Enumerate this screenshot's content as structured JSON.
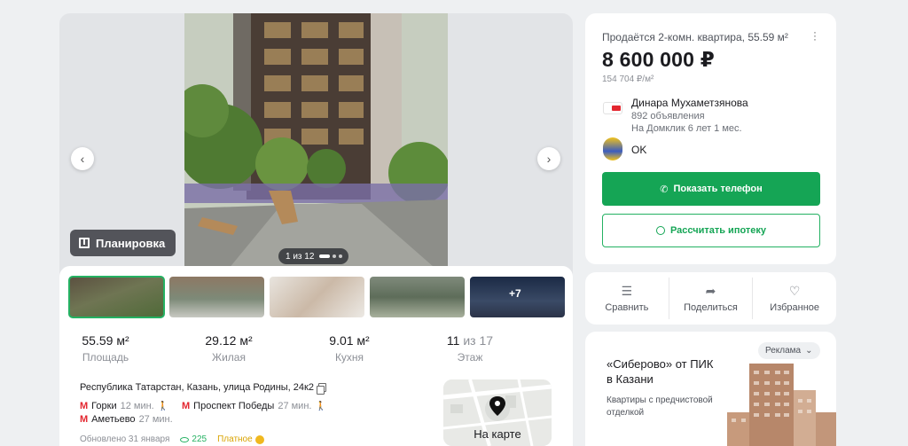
{
  "gallery": {
    "plan_label": "Планировка",
    "counter": "1 из 12",
    "extra_photos": "+7",
    "prev_icon": "chevron-left-icon",
    "next_icon": "chevron-right-icon"
  },
  "stats": [
    {
      "value": "55.59 м²",
      "label": "Площадь"
    },
    {
      "value": "29.12 м²",
      "label": "Жилая"
    },
    {
      "value": "9.01 м²",
      "label": "Кухня"
    },
    {
      "value": "11",
      "value_suffix": "из 17",
      "label": "Этаж"
    }
  ],
  "address": "Республика Татарстан, Казань, улица Родины, 24к2",
  "metro": [
    {
      "station": "Горки",
      "time": "12 мин."
    },
    {
      "station": "Проспект Победы",
      "time": "27 мин."
    },
    {
      "station": "Аметьево",
      "time": "27 мин."
    }
  ],
  "footer": {
    "updated": "Обновлено 31 января",
    "views": "225",
    "paid": "Платное"
  },
  "map": {
    "label": "На карте"
  },
  "listing": {
    "title": "Продаётся 2-комн. квартира, 55.59 м²",
    "price": "8 600 000 ₽",
    "price_per_m2": "154 704 ₽/м²"
  },
  "agent": {
    "name": "Динара Мухаметзянова",
    "listings": "892 объявления",
    "tenure": "На Домклик 6 лет 1 мес."
  },
  "ok_label": "OK",
  "buttons": {
    "phone": "Показать телефон",
    "mortgage": "Рассчитать ипотеку"
  },
  "actions": [
    {
      "label": "Сравнить",
      "icon": "compare-icon"
    },
    {
      "label": "Поделиться",
      "icon": "share-icon"
    },
    {
      "label": "Избранное",
      "icon": "heart-icon"
    }
  ],
  "promo": {
    "badge": "Реклама",
    "title": "«Сиберово» от ПИК в Казани",
    "subtitle": "Квартиры с предчистовой отделкой"
  },
  "colors": {
    "accent": "#15a555",
    "metro": "#e3262f",
    "paid": "#d9a300"
  }
}
